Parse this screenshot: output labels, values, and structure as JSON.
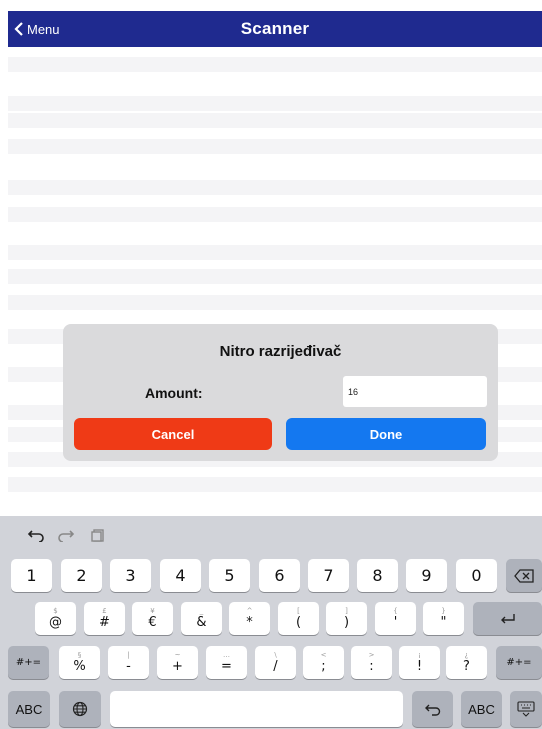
{
  "navbar": {
    "back_label": "Menu",
    "title": "Scanner",
    "color": "#1f2a8f"
  },
  "dialog": {
    "title": "Nitro razrijeđivač",
    "amount_label": "Amount:",
    "amount_value": "16",
    "cancel_label": "Cancel",
    "done_label": "Done",
    "cancel_color": "#ef3a16",
    "done_color": "#1478f0"
  },
  "keyboard": {
    "toolbar": [
      "undo-icon",
      "redo-icon",
      "paste-icon"
    ],
    "row1": [
      "1",
      "2",
      "3",
      "4",
      "5",
      "6",
      "7",
      "8",
      "9",
      "0"
    ],
    "row2": [
      {
        "alt": "$",
        "main": "@"
      },
      {
        "alt": "£",
        "main": "#"
      },
      {
        "alt": "¥",
        "main": "€"
      },
      {
        "alt": "_",
        "main": "&"
      },
      {
        "alt": "^",
        "main": "*"
      },
      {
        "alt": "[",
        "main": "("
      },
      {
        "alt": "]",
        "main": ")"
      },
      {
        "alt": "{",
        "main": "'"
      },
      {
        "alt": "}",
        "main": "\""
      }
    ],
    "row3": [
      {
        "alt": "§",
        "main": "%"
      },
      {
        "alt": "|",
        "main": "-"
      },
      {
        "alt": "~",
        "main": "+"
      },
      {
        "alt": "…",
        "main": "="
      },
      {
        "alt": "\\",
        "main": "/"
      },
      {
        "alt": "<",
        "main": ";"
      },
      {
        "alt": ">",
        "main": ":"
      },
      {
        "alt": "¡",
        "main": "!"
      },
      {
        "alt": "¿",
        "main": "?"
      }
    ],
    "shift_label": "#+=",
    "abc_label": "ABC",
    "abc_right_label": "ABC"
  }
}
